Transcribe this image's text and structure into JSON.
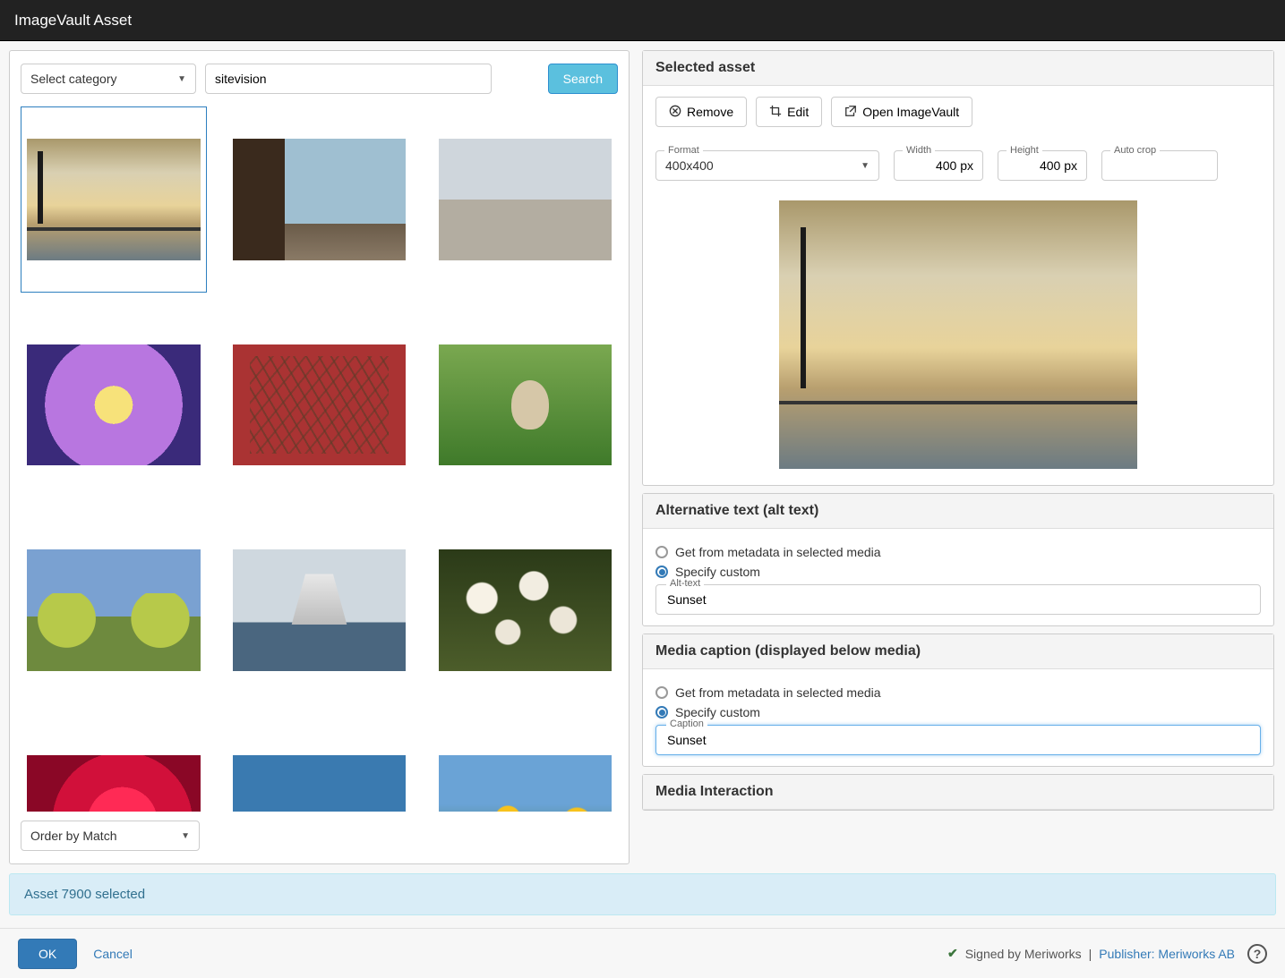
{
  "header": {
    "title": "ImageVault Asset"
  },
  "search": {
    "category_placeholder": "Select category",
    "query": "sitevision",
    "button": "Search"
  },
  "order": {
    "label": "Order by Match"
  },
  "thumbnails": [
    {
      "key": "sunset",
      "selected": true
    },
    {
      "key": "door",
      "selected": false
    },
    {
      "key": "stones",
      "selected": false
    },
    {
      "key": "flower",
      "selected": false
    },
    {
      "key": "redwall",
      "selected": false
    },
    {
      "key": "hedge",
      "selected": false
    },
    {
      "key": "trees",
      "selected": false
    },
    {
      "key": "ship",
      "selected": false
    },
    {
      "key": "blossom",
      "selected": false
    },
    {
      "key": "rose",
      "selected": false
    },
    {
      "key": "bird",
      "selected": false
    },
    {
      "key": "daff",
      "selected": false
    }
  ],
  "selected_asset": {
    "title": "Selected asset",
    "btn_remove": "Remove",
    "btn_edit": "Edit",
    "btn_open": "Open ImageVault",
    "format_label": "Format",
    "format_value": "400x400",
    "width_label": "Width",
    "width_value": "400 px",
    "height_label": "Height",
    "height_value": "400 px",
    "autocrop_label": "Auto crop",
    "autocrop_value": ""
  },
  "alt_text": {
    "title": "Alternative text (alt text)",
    "opt_meta": "Get from metadata in selected media",
    "opt_custom": "Specify custom",
    "field_label": "Alt-text",
    "value": "Sunset",
    "selected": "custom"
  },
  "caption": {
    "title": "Media caption (displayed below media)",
    "opt_meta": "Get from metadata in selected media",
    "opt_custom": "Specify custom",
    "field_label": "Caption",
    "value": "Sunset",
    "selected": "custom"
  },
  "interaction": {
    "title": "Media Interaction"
  },
  "status": {
    "message": "Asset 7900 selected"
  },
  "footer": {
    "ok": "OK",
    "cancel": "Cancel",
    "signed": "Signed by Meriworks",
    "sep": " | ",
    "publisher": "Publisher: Meriworks AB"
  }
}
